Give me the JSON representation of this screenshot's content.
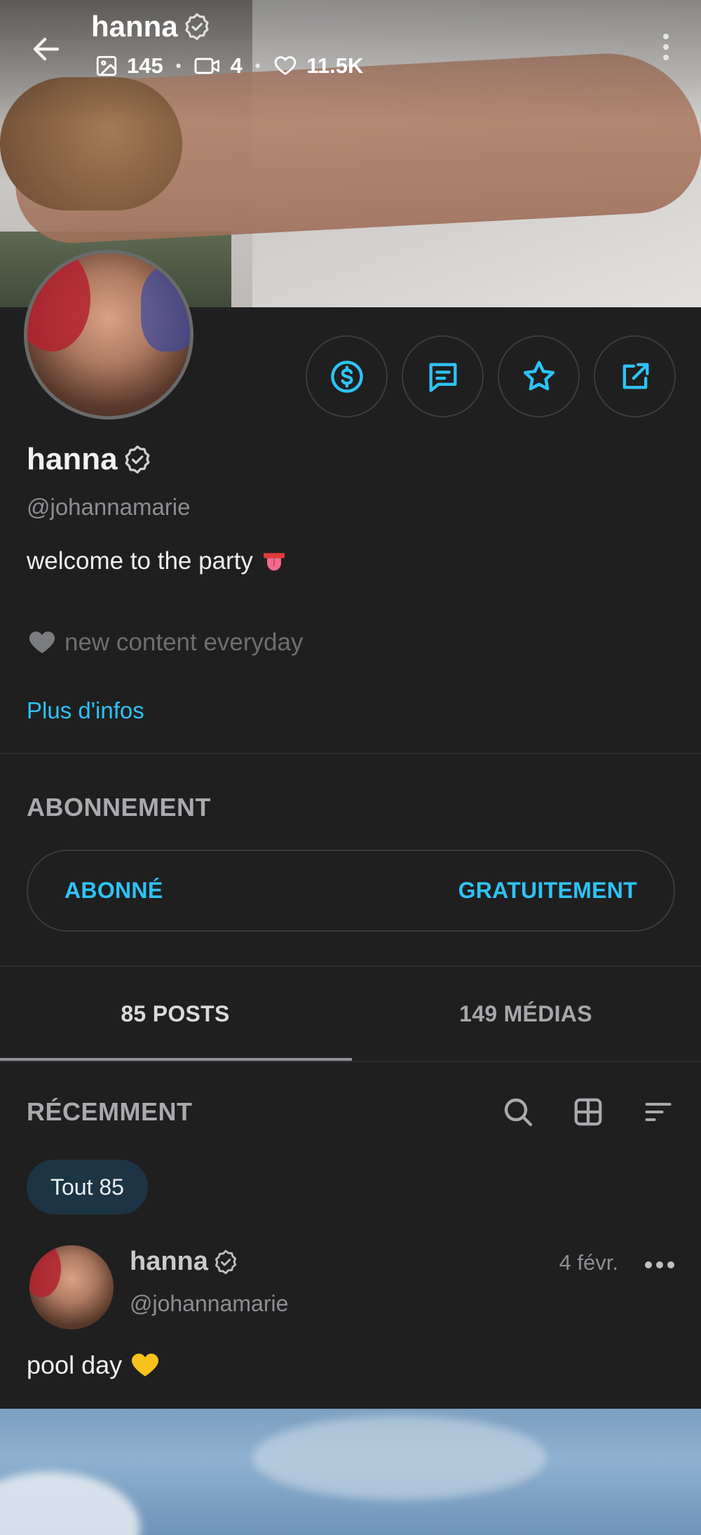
{
  "header": {
    "name": "hanna",
    "stats": {
      "images": "145",
      "videos": "4",
      "likes": "11.5K"
    }
  },
  "profile": {
    "name": "hanna",
    "handle": "@johannamarie",
    "bio_line1": "welcome to the party",
    "bio_line2": "new content everyday",
    "more_link": "Plus d'infos"
  },
  "subscription": {
    "title": "ABONNEMENT",
    "status": "ABONNÉ",
    "price": "GRATUITEMENT"
  },
  "tabs": [
    {
      "label": "85 POSTS",
      "active": true
    },
    {
      "label": "149 MÉDIAS",
      "active": false
    }
  ],
  "feed": {
    "section_label": "RÉCEMMENT",
    "filter_chip": "Tout 85"
  },
  "post": {
    "author": "hanna",
    "handle": "@johannamarie",
    "date": "4 févr.",
    "text": "pool day"
  },
  "colors": {
    "accent": "#2ec3f5",
    "background": "#1f1f20",
    "chip_bg": "#1c3444"
  }
}
